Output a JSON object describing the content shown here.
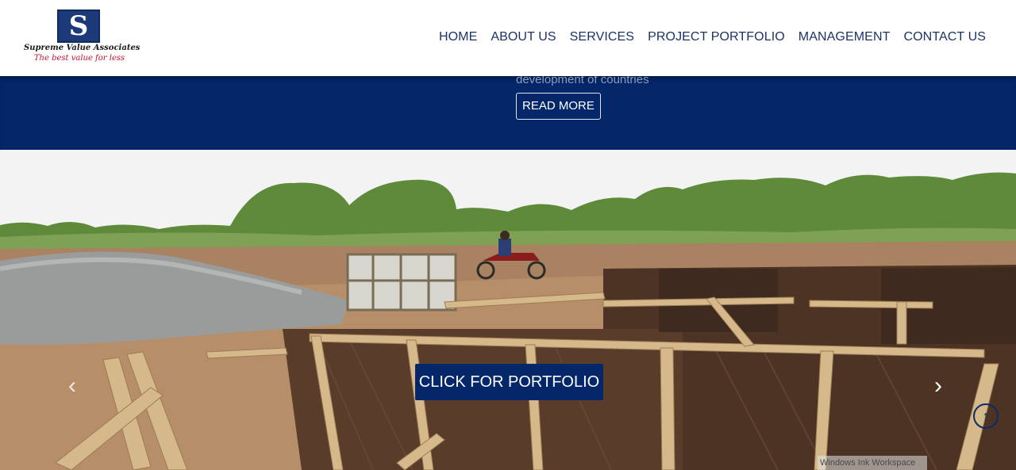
{
  "brand": {
    "logo_letter": "S",
    "name": "Supreme Value Associates",
    "tagline": "The best value for less",
    "colors": {
      "navy": "#04276a",
      "logo_box": "#1d3a78",
      "tagline_red": "#c8102e",
      "nav_text": "#1d3366"
    }
  },
  "nav": {
    "items": [
      {
        "label": "HOME"
      },
      {
        "label": "ABOUT US"
      },
      {
        "label": "SERVICES"
      },
      {
        "label": "PROJECT PORTFOLIO"
      },
      {
        "label": "MANAGEMENT"
      },
      {
        "label": "CONTACT US"
      }
    ]
  },
  "band": {
    "text": "development of countries",
    "read_more_label": "READ MORE"
  },
  "hero": {
    "cta_label": "CLICK FOR PORTFOLIO",
    "prev_icon": "chevron-left-icon",
    "next_icon": "chevron-right-icon",
    "prev_glyph": "‹",
    "next_glyph": "›",
    "scroll_top_glyph": "↑",
    "watermark": "Windows Ink Workspace"
  }
}
